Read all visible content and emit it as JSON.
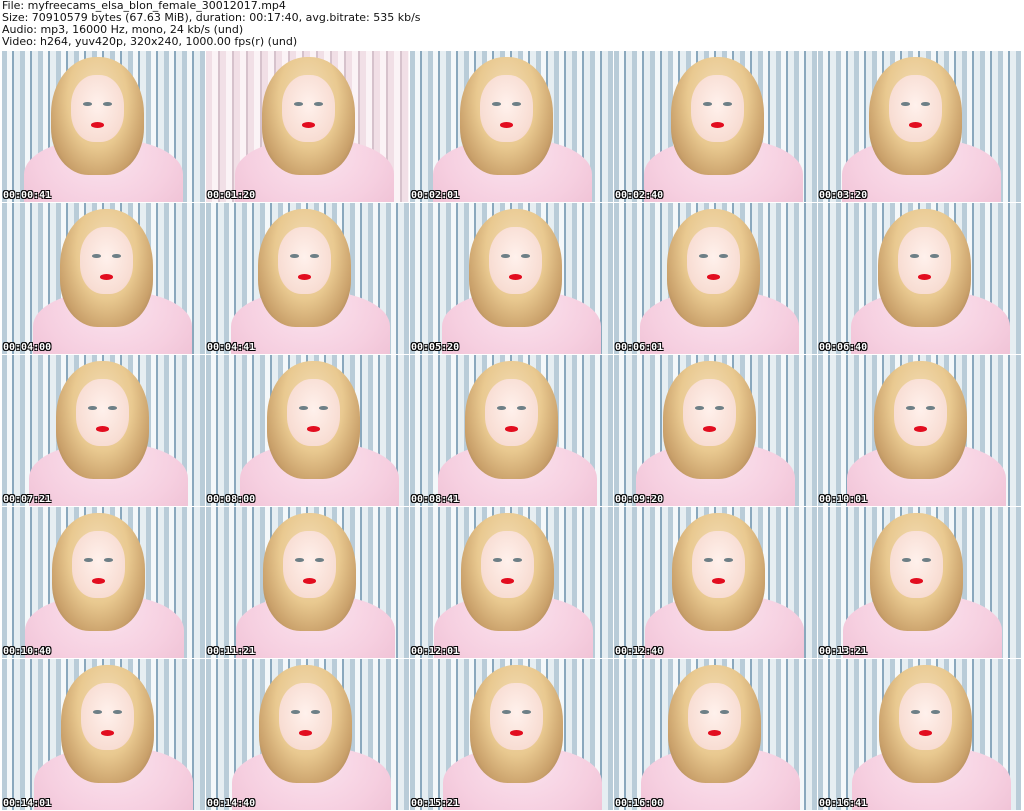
{
  "header": {
    "file_line": "File: myfreecams_elsa_blon_female_30012017.mp4",
    "size_line": "Size: 70910579 bytes (67.63 MiB), duration: 00:17:40, avg.bitrate: 535 kb/s",
    "audio_line": "Audio: mp3, 16000 Hz, mono, 24 kb/s (und)",
    "video_line": "Video: h264, yuv420p, 320x240, 1000.00 fps(r) (und)"
  },
  "thumbnails": [
    {
      "timestamp": "00:00:41"
    },
    {
      "timestamp": "00:01:20"
    },
    {
      "timestamp": "00:02:01"
    },
    {
      "timestamp": "00:02:40"
    },
    {
      "timestamp": "00:03:20"
    },
    {
      "timestamp": "00:04:00"
    },
    {
      "timestamp": "00:04:41"
    },
    {
      "timestamp": "00:05:20"
    },
    {
      "timestamp": "00:06:01"
    },
    {
      "timestamp": "00:06:40"
    },
    {
      "timestamp": "00:07:21"
    },
    {
      "timestamp": "00:08:00"
    },
    {
      "timestamp": "00:08:41"
    },
    {
      "timestamp": "00:09:20"
    },
    {
      "timestamp": "00:10:01"
    },
    {
      "timestamp": "00:10:40"
    },
    {
      "timestamp": "00:11:21"
    },
    {
      "timestamp": "00:12:01"
    },
    {
      "timestamp": "00:12:40"
    },
    {
      "timestamp": "00:13:21"
    },
    {
      "timestamp": "00:14:01"
    },
    {
      "timestamp": "00:14:40"
    },
    {
      "timestamp": "00:15:21"
    },
    {
      "timestamp": "00:16:00"
    },
    {
      "timestamp": "00:16:41"
    }
  ]
}
